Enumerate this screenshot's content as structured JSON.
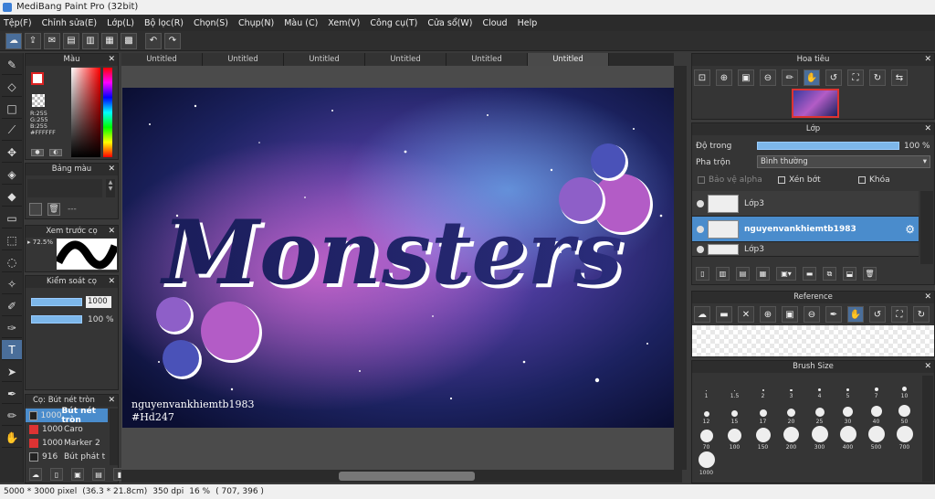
{
  "app": {
    "title": "MediBang Paint Pro (32bit)"
  },
  "menu": [
    "Tệp(F)",
    "Chỉnh sửa(E)",
    "Lớp(L)",
    "Bộ lọc(R)",
    "Chọn(S)",
    "Chụp(N)",
    "Màu (C)",
    "Xem(V)",
    "Công cụ(T)",
    "Cửa sổ(W)",
    "Cloud",
    "Help"
  ],
  "tabs": [
    "Untitled",
    "Untitled",
    "Untitled",
    "Untitled",
    "Untitled",
    "Untitled"
  ],
  "color_panel": {
    "title": "Màu",
    "r": "R:255",
    "g": "G:255",
    "b": "B:255",
    "hex": "#FFFFFF"
  },
  "palette_panel": {
    "title": "Bảng màu",
    "dash": "---"
  },
  "preview_panel": {
    "title": "Xem trước cọ",
    "value": "72.5%"
  },
  "brush_control": {
    "title": "Kiểm soát cọ",
    "size": "1000",
    "opacity": "100 %"
  },
  "brush_list": {
    "title": "Cọ: Bút nét tròn",
    "items": [
      {
        "size": "1000",
        "name": "Bút nét tròn",
        "color": "#222"
      },
      {
        "size": "1000",
        "name": "Caro",
        "color": "#d33"
      },
      {
        "size": "1000",
        "name": "Marker 2",
        "color": "#d33"
      },
      {
        "size": "916",
        "name": "Bút phát t",
        "color": "#222"
      }
    ]
  },
  "navigator": {
    "title": "Hoa tiêu"
  },
  "layers": {
    "title": "Lớp",
    "opacity_label": "Độ trong",
    "opacity_value": "100 %",
    "opacity": 1.0,
    "blend_label": "Pha trộn",
    "blend_value": "Bình thường",
    "protect_alpha": "Bảo vệ alpha",
    "clipping": "Xén bớt",
    "lock": "Khóa",
    "items": [
      {
        "name": "Lớp3",
        "selected": false
      },
      {
        "name": "nguyenvankhiemtb1983",
        "selected": true
      },
      {
        "name": "Lớp3",
        "selected": false
      }
    ]
  },
  "reference": {
    "title": "Reference"
  },
  "brush_size": {
    "title": "Brush Size",
    "sizes": [
      "1",
      "1.5",
      "2",
      "3",
      "4",
      "5",
      "7",
      "10",
      "12",
      "15",
      "17",
      "20",
      "25",
      "30",
      "40",
      "50",
      "70",
      "100",
      "150",
      "200",
      "300",
      "400",
      "500",
      "700",
      "1000"
    ]
  },
  "artwork": {
    "main_text": "Monsters",
    "credit": "nguyenvankhiemtb1983",
    "tag": "#Hd247"
  },
  "status": {
    "size": "5000 * 3000 pixel",
    "cm": "(36.3 * 21.8cm)",
    "dpi": "350 dpi",
    "zoom": "16 %",
    "coords": "( 707, 396 )"
  }
}
